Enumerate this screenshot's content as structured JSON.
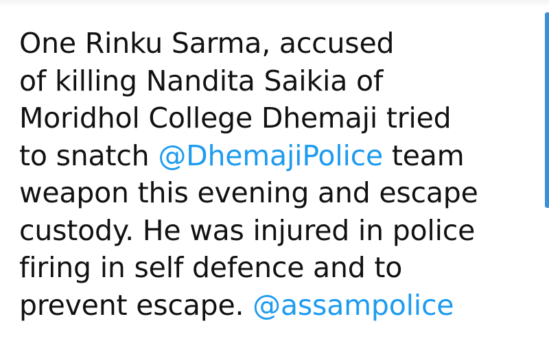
{
  "tweet": {
    "line1": "One Rinku Sarma, accused",
    "line2": "of killing Nandita Saikia of",
    "line3": "Moridhol College Dhemaji tried",
    "line4_prefix": "to snatch ",
    "line4_mention": "@DhemajiPolice",
    "line4_suffix": " team",
    "line5": "weapon this evening and escape",
    "line6": "custody. He was injured in police",
    "line7": "firing in self defence and to",
    "line8_prefix": "prevent escape. ",
    "line8_mention": "@assampolice"
  },
  "colors": {
    "text": "#111111",
    "mention": "#1d9bf0",
    "accent": "#3b8fd8",
    "background": "#ffffff"
  }
}
